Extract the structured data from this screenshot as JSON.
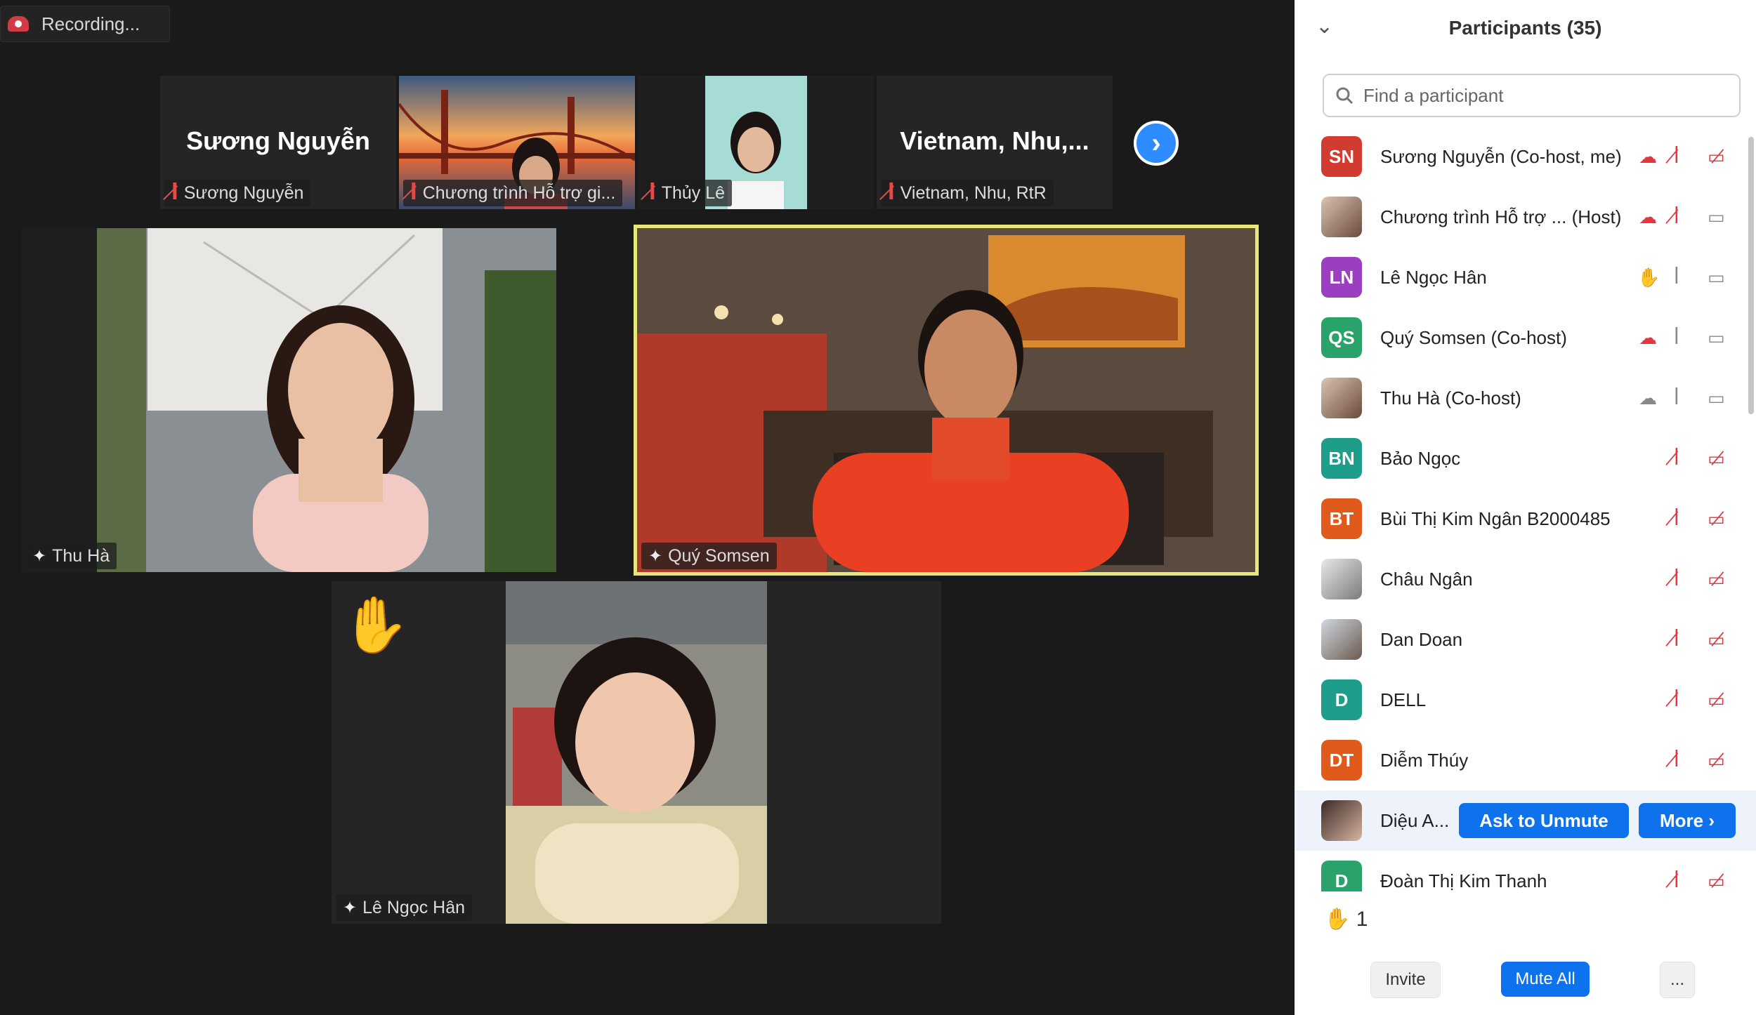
{
  "recording": {
    "label": "Recording..."
  },
  "strip": [
    {
      "big_name": "Sương Nguyễn",
      "tag": "Sương Nguyễn"
    },
    {
      "big_name": "",
      "tag": "Chương trình Hỗ trợ gi..."
    },
    {
      "big_name": "",
      "tag": "Thủy Lê"
    },
    {
      "big_name": "Vietnam,  Nhu,...",
      "tag": "Vietnam, Nhu, RtR"
    }
  ],
  "gallery": [
    {
      "tag": "Thu Hà"
    },
    {
      "tag": "Quý Somsen"
    },
    {
      "tag": "Lê Ngọc Hân"
    }
  ],
  "panel": {
    "title": "Participants (35)",
    "search_placeholder": "Find a participant",
    "participants": [
      {
        "initials": "SN",
        "name": "Sương Nguyễn (Co-host, me)",
        "color": "#d23b2f"
      },
      {
        "initials": "",
        "name": "Chương trình Hỗ trợ ... (Host)",
        "color": ""
      },
      {
        "initials": "LN",
        "name": "Lê Ngọc Hân",
        "color": "#9b3fc0"
      },
      {
        "initials": "QS",
        "name": "Quý Somsen (Co-host)",
        "color": "#2aa36b"
      },
      {
        "initials": "",
        "name": "Thu Hà (Co-host)",
        "color": ""
      },
      {
        "initials": "BN",
        "name": "Bảo Ngọc",
        "color": "#1e9e8a"
      },
      {
        "initials": "BT",
        "name": "Bùi Thị Kim Ngân B2000485",
        "color": "#e05a1c"
      },
      {
        "initials": "",
        "name": "Châu Ngân",
        "color": ""
      },
      {
        "initials": "",
        "name": "Dan Doan",
        "color": ""
      },
      {
        "initials": "D",
        "name": "DELL",
        "color": "#1e9e8a"
      },
      {
        "initials": "DT",
        "name": "Diễm Thúy",
        "color": "#e05a1c"
      },
      {
        "initials": "",
        "name": "Diệu A...",
        "color": ""
      },
      {
        "initials": "D",
        "name": "Đoàn Thị Kim Thanh",
        "color": "#2aa36b"
      }
    ],
    "ask_unmute": "Ask to Unmute",
    "more": "More ›",
    "raised_count": "1",
    "invite": "Invite",
    "mute_all": "Mute All",
    "ellipsis": "..."
  }
}
